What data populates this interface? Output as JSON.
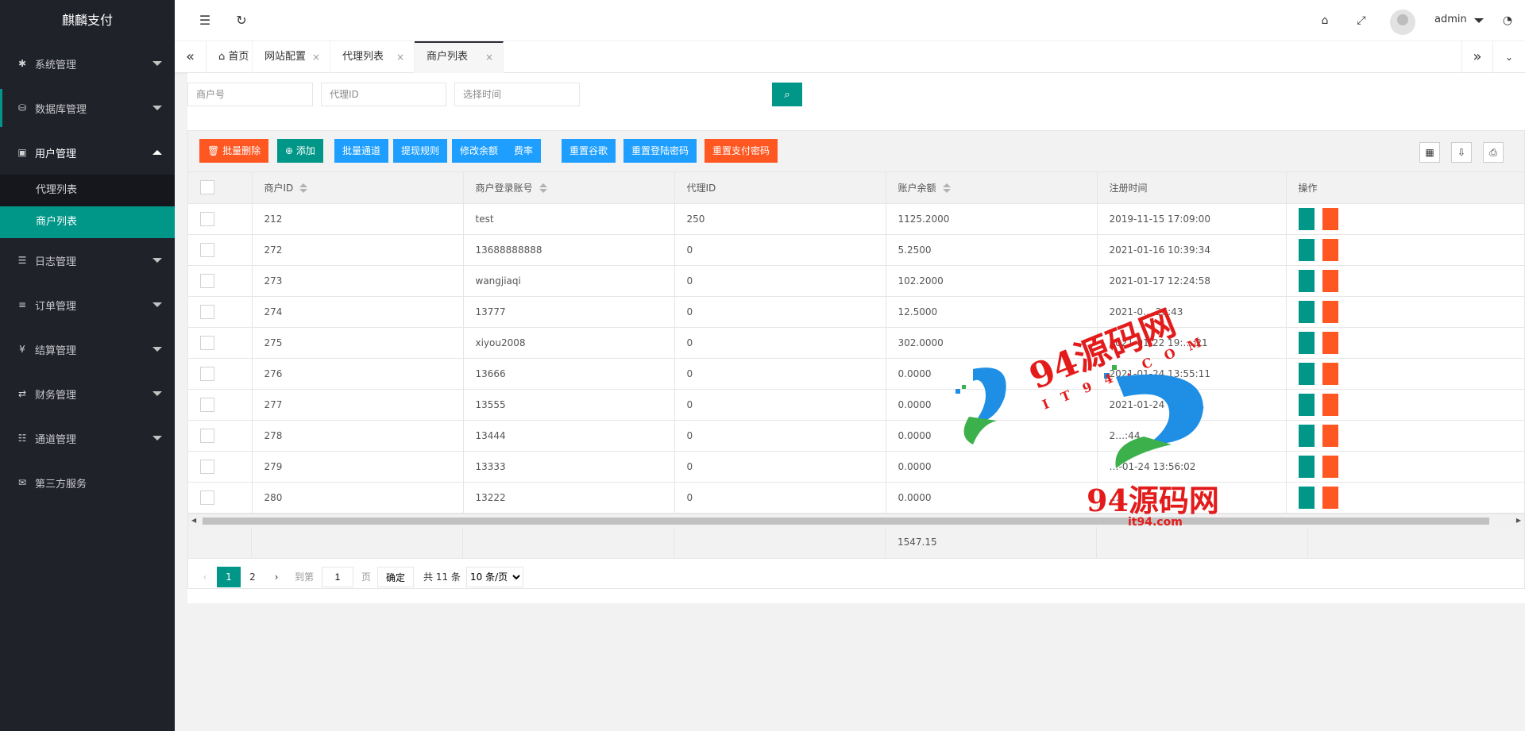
{
  "app": {
    "title": "麒麟支付"
  },
  "sidebar": {
    "items": [
      {
        "label": "系统管理",
        "icon": "gear-icon",
        "glyph": "✱",
        "has_arrow": true
      },
      {
        "label": "数据库管理",
        "icon": "database-icon",
        "glyph": "⛁",
        "has_arrow": true
      },
      {
        "label": "用户管理",
        "icon": "user-icon",
        "glyph": "▣",
        "has_arrow": true,
        "open": true
      },
      {
        "label": "日志管理",
        "icon": "log-icon",
        "glyph": "☰",
        "has_arrow": true
      },
      {
        "label": "订单管理",
        "icon": "list-icon",
        "glyph": "≡",
        "has_arrow": true
      },
      {
        "label": "结算管理",
        "icon": "yen-icon",
        "glyph": "¥",
        "has_arrow": true
      },
      {
        "label": "财务管理",
        "icon": "transfer-icon",
        "glyph": "⇄",
        "has_arrow": true
      },
      {
        "label": "通道管理",
        "icon": "channel-icon",
        "glyph": "☷",
        "has_arrow": true
      },
      {
        "label": "第三方服务",
        "icon": "mail-icon",
        "glyph": "✉",
        "has_arrow": false
      }
    ],
    "submenu": [
      {
        "label": "代理列表",
        "active": false
      },
      {
        "label": "商户列表",
        "active": true
      }
    ]
  },
  "header": {
    "username": "admin"
  },
  "tabs": [
    {
      "label": "首页",
      "closable": false
    },
    {
      "label": "网站配置",
      "closable": true
    },
    {
      "label": "代理列表",
      "closable": true
    },
    {
      "label": "商户列表",
      "closable": true,
      "active": true
    }
  ],
  "search": {
    "merchant_placeholder": "商户号",
    "agent_placeholder": "代理ID",
    "time_placeholder": "选择时间"
  },
  "toolbar": {
    "buttons": [
      {
        "label": "批量删除",
        "color": "red",
        "icon": "trash-icon"
      },
      {
        "label": "添加",
        "color": "green",
        "icon": "plus-circle-icon"
      },
      {
        "label": "批量通道",
        "color": "blue"
      },
      {
        "label": "提现规则",
        "color": "blue"
      },
      {
        "label": "修改余额",
        "color": "blue"
      },
      {
        "label": "费率",
        "color": "blue"
      },
      {
        "label": "重置谷歌",
        "color": "blue"
      },
      {
        "label": "重置登陆密码",
        "color": "blue"
      },
      {
        "label": "重置支付密码",
        "color": "red"
      }
    ]
  },
  "table": {
    "columns": [
      "商户ID",
      "商户登录账号",
      "代理ID",
      "账户余额",
      "注册时间",
      "操作"
    ],
    "rows": [
      [
        "212",
        "test",
        "250",
        "1125.2000",
        "2019-11-15 17:09:00"
      ],
      [
        "272",
        "13688888888",
        "0",
        "5.2500",
        "2021-01-16 10:39:34"
      ],
      [
        "273",
        "wangjiaqi",
        "0",
        "102.2000",
        "2021-01-17 12:24:58"
      ],
      [
        "274",
        "13777",
        "0",
        "12.5000",
        "2021-0… 26:43"
      ],
      [
        "275",
        "xiyou2008",
        "0",
        "302.0000",
        "2021-01-22 19:…:21"
      ],
      [
        "276",
        "13666",
        "0",
        "0.0000",
        "2021-01-24 13:55:11"
      ],
      [
        "277",
        "13555",
        "0",
        "0.0000",
        "2021-01-24 13:55…"
      ],
      [
        "278",
        "13444",
        "0",
        "0.0000",
        "2…:44"
      ],
      [
        "279",
        "13333",
        "0",
        "0.0000",
        "…-01-24 13:56:02"
      ],
      [
        "280",
        "13222",
        "0",
        "0.0000",
        "…"
      ]
    ],
    "total_balance": "1547.15"
  },
  "pager": {
    "pages": [
      "1",
      "2"
    ],
    "current": "1",
    "goto_label": "到第",
    "goto_value": "1",
    "page_unit": "页",
    "confirm": "确定",
    "total": "共 11 条",
    "page_size": "10 条/页"
  },
  "watermark": {
    "text1": "94源码网",
    "text2": "I T 9 4 . C O M",
    "text3": "94源码网",
    "text4": "it94.com"
  }
}
